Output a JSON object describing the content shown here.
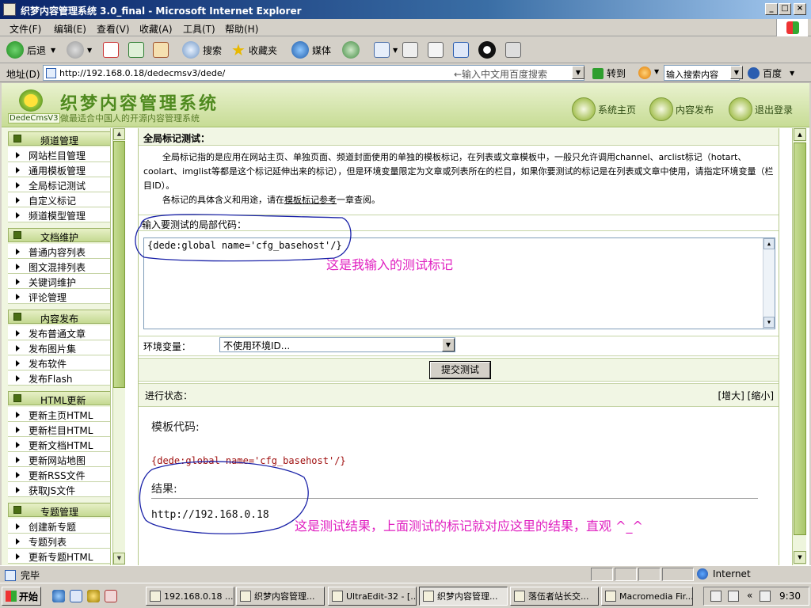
{
  "window": {
    "title": "织梦内容管理系统 3.0_final - Microsoft Internet Explorer",
    "controls": [
      "_",
      "□",
      "×"
    ]
  },
  "menu": [
    "文件(F)",
    "编辑(E)",
    "查看(V)",
    "收藏(A)",
    "工具(T)",
    "帮助(H)"
  ],
  "toolbar": {
    "back": "后退",
    "search": "搜索",
    "favorites": "收藏夹",
    "media": "媒体"
  },
  "address": {
    "label": "地址(D)",
    "url": "http://192.168.0.18/dedecmsv3/dede/",
    "hint": "←输入中文用百度搜索",
    "go": "转到",
    "search_value": "输入搜索内容",
    "engine": "百度"
  },
  "header": {
    "version": "DedeCmsV3",
    "brand": "织梦内容管理系统",
    "slogan": "做最适合中国人的开源内容管理系统",
    "links": [
      "系统主页",
      "内容发布",
      "退出登录"
    ]
  },
  "sidebar": {
    "sections": [
      {
        "title": "频道管理",
        "items": [
          "网站栏目管理",
          "通用模板管理",
          "全局标记测试",
          "自定义标记",
          "频道模型管理"
        ]
      },
      {
        "title": "文档维护",
        "items": [
          "普通内容列表",
          "图文混排列表",
          "关键词维护",
          "评论管理"
        ]
      },
      {
        "title": "内容发布",
        "items": [
          "发布普通文章",
          "发布图片集",
          "发布软件",
          "发布Flash"
        ]
      },
      {
        "title": "HTML更新",
        "items": [
          "更新主页HTML",
          "更新栏目HTML",
          "更新文档HTML",
          "更新网站地图",
          "更新RSS文件",
          "获取JS文件"
        ]
      },
      {
        "title": "专题管理",
        "items": [
          "创建新专题",
          "专题列表",
          "更新专题HTML"
        ]
      }
    ]
  },
  "content": {
    "title": "全局标记测试：",
    "desc1": "全局标记指的是应用在网站主页、单独页面、频道封面使用的单独的模板标记，在列表或文章模板中，一般只允许调用channel、arclist标记（hotart、coolart、imglist等都是这个标记延伸出来的标记），但是环境变量限定为文章或列表所在的栏目，如果你要测试的标记是在列表或文章中使用，请指定环境变量（栏目ID）。",
    "desc2_pre": "各标记的具体含义和用途，请在",
    "desc2_link": "模板标记参考",
    "desc2_post": "一章查阅。",
    "input_label": "输入要测试的局部代码：",
    "code": "{dede:global name='cfg_basehost'/}",
    "env_label": "环境变量：",
    "env_value": "不使用环境ID...",
    "submit": "提交测试",
    "status_label": "进行状态：",
    "zoom": "[增大] [缩小]",
    "template_heading": "模板代码:",
    "template_code": "{dede:global name='cfg_basehost'/}",
    "result_heading": "结果:",
    "result_value": "http://192.168.0.18"
  },
  "annotations": {
    "note1": "这是我输入的测试标记",
    "note2": "这是测试结果，上面测试的标记就对应这里的结果，直观 ^_^"
  },
  "statusbar": {
    "done": "完毕",
    "zone": "Internet"
  },
  "taskbar": {
    "start": "开始",
    "tasks": [
      "192.168.0.18 ...",
      "织梦内容管理...",
      "UltraEdit-32 - [...",
      "织梦内容管理...",
      "落伍者站长交...",
      "Macromedia Fir..."
    ],
    "active_index": 3,
    "time": "9:30"
  }
}
